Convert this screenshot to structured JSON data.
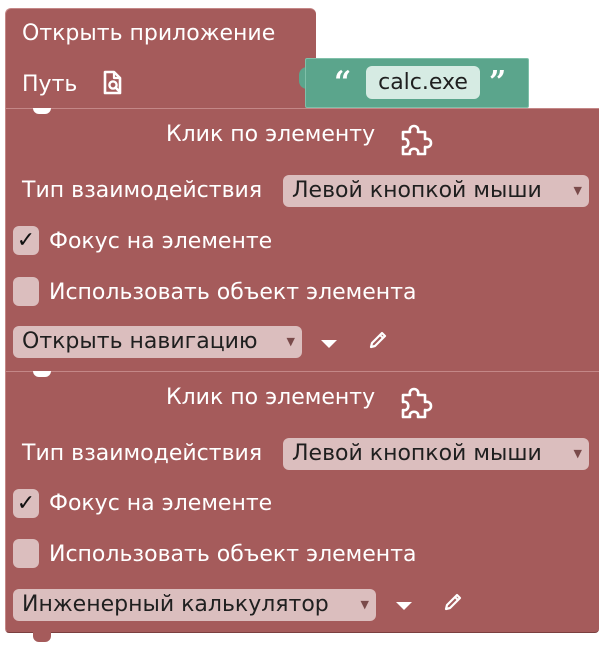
{
  "open_app_block": {
    "title": "Открыть приложение",
    "path_label": "Путь",
    "path_icon": "file-search-icon",
    "path_value": "calc.exe",
    "quote_open": "“",
    "quote_close": "”"
  },
  "click_blocks": [
    {
      "title": "Клик по элементу",
      "puzzle_icon": "puzzle-icon",
      "interaction_label": "Тип взаимодействия",
      "interaction_value": "Левой кнопкой мыши",
      "focus_label": "Фокус на элементе",
      "focus_checked": true,
      "check_mark": "✓",
      "use_object_label": "Использовать объект элемента",
      "use_object_checked": false,
      "element_value": "Открыть навигацию"
    },
    {
      "title": "Клик по элементу",
      "puzzle_icon": "puzzle-icon",
      "interaction_label": "Тип взаимодействия",
      "interaction_value": "Левой кнопкой мыши",
      "focus_label": "Фокус на элементе",
      "focus_checked": true,
      "check_mark": "✓",
      "use_object_label": "Использовать объект элемента",
      "use_object_checked": false,
      "element_value": "Инженерный калькулятор"
    }
  ],
  "colors": {
    "block": "#a55b5b",
    "string_block": "#5ba58c",
    "field": "#dbbebe"
  }
}
